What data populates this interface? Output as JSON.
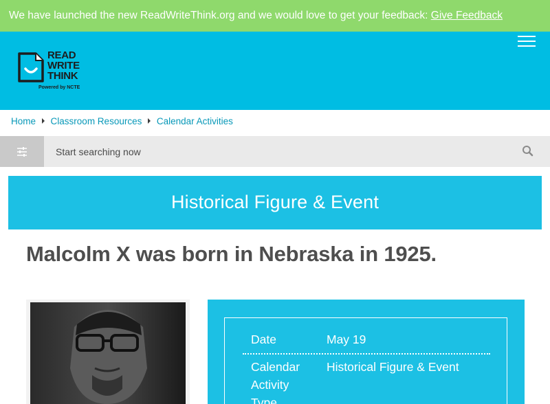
{
  "banner": {
    "text": "We have launched the new ReadWriteThink.org and we would love to get your feedback: ",
    "link_label": "Give Feedback"
  },
  "header": {
    "logo": {
      "line1": "READ",
      "line2": "WRITE",
      "line3": "THINK",
      "tagline": "Powered by NCTE"
    },
    "menu_icon": "hamburger-icon"
  },
  "breadcrumb": [
    "Home",
    "Classroom Resources",
    "Calendar Activities"
  ],
  "search": {
    "placeholder": "Start searching now",
    "filter_icon": "sliders-icon",
    "search_icon": "magnifier-icon"
  },
  "category": "Historical Figure & Event",
  "title": "Malcolm X was born in Nebraska in 1925.",
  "details": {
    "date_label": "Date",
    "date_value": "May 19",
    "type_label_1": "Calendar",
    "type_label_2": "Activity",
    "type_label_3": "Type",
    "type_value": "Historical Figure & Event"
  },
  "colors": {
    "banner": "#8fd96c",
    "header": "#00bde3",
    "accent": "#1cc0e4",
    "link": "#0798b8",
    "title": "#4e4e4e"
  }
}
